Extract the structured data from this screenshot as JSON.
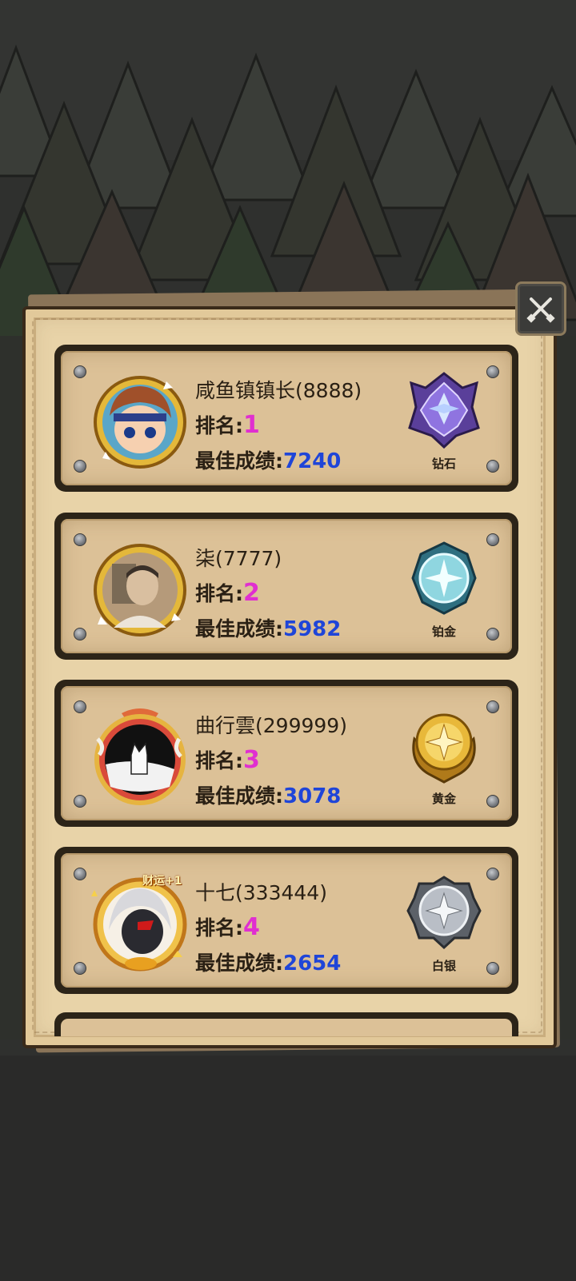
{
  "close_button": {
    "icon": "crossed-swords-icon"
  },
  "players": [
    {
      "name": "咸鱼镇镇长(8888)",
      "rank_label": "排名:",
      "rank": "1",
      "score_label": "最佳成绩:",
      "score": "7240",
      "tier": "钻石",
      "tier_color": "#6a4fd0"
    },
    {
      "name": "柒(7777)",
      "rank_label": "排名:",
      "rank": "2",
      "score_label": "最佳成绩:",
      "score": "5982",
      "tier": "铂金",
      "tier_color": "#49a9b8"
    },
    {
      "name": "曲行雲(299999)",
      "rank_label": "排名:",
      "rank": "3",
      "score_label": "最佳成绩:",
      "score": "3078",
      "tier": "黄金",
      "tier_color": "#d6a22a"
    },
    {
      "name": "十七(333444)",
      "rank_label": "排名:",
      "rank": "4",
      "score_label": "最佳成绩:",
      "score": "2654",
      "tier": "白银",
      "tier_color": "#9aa0a8",
      "avatar_badge": "财运+1"
    }
  ],
  "colors": {
    "rank": "#e02fd0",
    "score": "#1f45d8",
    "parchment": "#e8d3a8"
  }
}
